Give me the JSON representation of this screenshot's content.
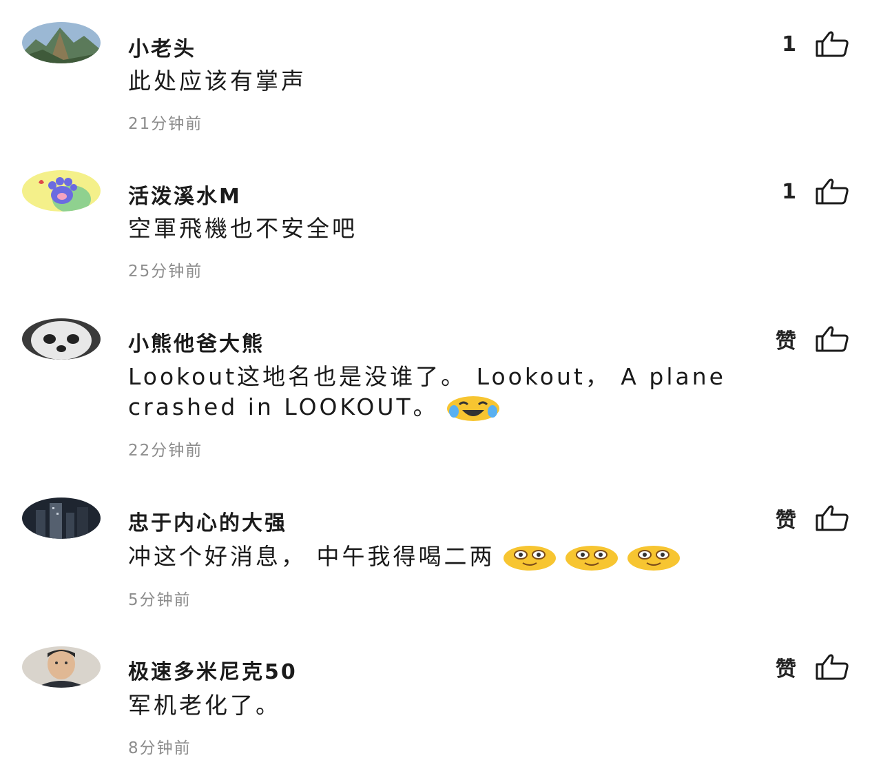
{
  "comments": [
    {
      "username": "小老头",
      "like": "1",
      "text": "此处应该有掌声",
      "time": "21分钟前"
    },
    {
      "username": "活泼溪水M",
      "like": "1",
      "text": "空軍飛機也不安全吧",
      "time": "25分钟前"
    },
    {
      "username": "小熊他爸大熊",
      "like": "赞",
      "text": "Lookout这地名也是没谁了。 Lookout， A plane crashed in LOOKOUT。",
      "time": "22分钟前"
    },
    {
      "username": "忠于内心的大强",
      "like": "赞",
      "text": "冲这个好消息， 中午我得喝二两",
      "time": "5分钟前"
    },
    {
      "username": "极速多米尼克50",
      "like": "赞",
      "text": "军机老化了。",
      "time": "8分钟前"
    }
  ],
  "icons": {
    "like": "thumbs-up-icon",
    "emoji_laugh": "laughing-crying-emoji-icon",
    "emoji_nerd": "nerd-glasses-emoji-icon"
  },
  "colors": {
    "text": "#1a1a1a",
    "time": "#8c8c8c",
    "background": "#ffffff"
  }
}
